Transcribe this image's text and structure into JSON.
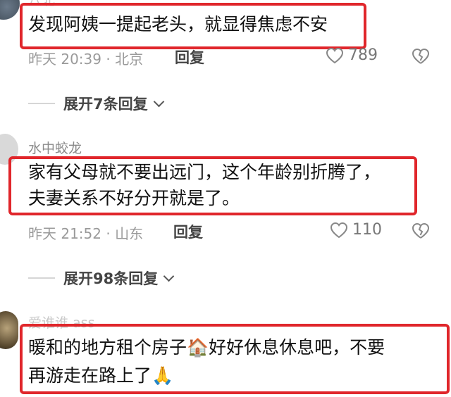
{
  "comments": [
    {
      "text": "发现阿姨一提起老头，就显得焦虑不安",
      "time_location": "昨天 20:39 · 北京",
      "reply_label": "回复",
      "likes": "789",
      "expand_label": "展开7条回复"
    },
    {
      "username": "水中蛟龙",
      "text_line1": "家有父母就不要出远门，这个年龄别折腾了，",
      "text_line2": "夫妻关系不好分开就是了。",
      "time_location": "昨天 21:52 · 山东",
      "reply_label": "回复",
      "likes": "110",
      "expand_label": "展开98条回复"
    },
    {
      "username": "爱谁谁 ass",
      "text_line1_a": "暖和的地方租个房子",
      "house_emoji": "🏠",
      "text_line1_b": "好好休息休息吧，不要",
      "text_line2": "再游走在路上了",
      "pray_emoji": "🙏"
    }
  ],
  "colors": {
    "highlight_box": "#e0262b",
    "meta_text": "#9a9a9a"
  },
  "icons": [
    "heart-icon",
    "broken-heart-icon",
    "chevron-down-icon"
  ]
}
